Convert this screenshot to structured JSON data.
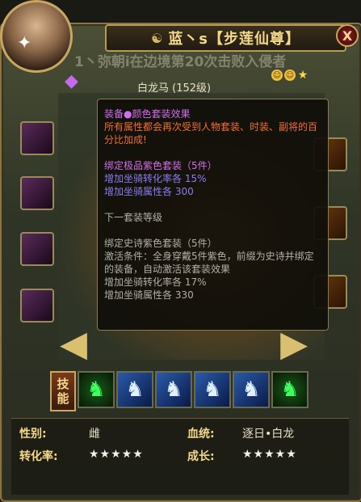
{
  "title": {
    "prefix_icon": "swirl-icon",
    "text": "蓝丶s【步莲仙尊】",
    "close_label": "X"
  },
  "scroll_text": "1丶弥朝i在边境第20次击败入侵者",
  "mount": {
    "name": "白龙马 (152级)"
  },
  "tooltip": {
    "title": "装备●颜色套装效果",
    "warning": "所有属性都会再次受到人物套装、时装、副将的百分比加成!",
    "current_set_title": "绑定极品紫色套装（5件）",
    "current_set_stat1": "增加坐骑转化率各   15%",
    "current_set_stat2": "增加坐骑属性各  300",
    "next_level_label": "下一套装等级",
    "next_set_title": "绑定史诗紫色套装（5件）",
    "next_set_condition": "激活条件：全身穿戴5件紫色，前缀为史诗并绑定的装备，自动激活该套装效果",
    "next_set_stat1": "增加坐骑转化率各   17%",
    "next_set_stat2": "增加坐骑属性各 330"
  },
  "skills": {
    "label_top": "技",
    "label_bottom": "能",
    "icons": [
      "horse-green-icon",
      "horse-blue-icon",
      "horse-blue-icon",
      "horse-blue-icon",
      "horse-blue-icon",
      "horse-green-icon"
    ]
  },
  "info": {
    "gender_label": "性别:",
    "gender_value": "雌",
    "bloodline_label": "血统:",
    "bloodline_value": "逐日•白龙",
    "conversion_label": "转化率:",
    "conversion_stars": "★★★★★",
    "growth_label": "成长:",
    "growth_stars": "★★★★★"
  },
  "colors": {
    "purple": "#d070e8",
    "orange": "#f07030",
    "blue": "#8a7ef0",
    "gold": "#f4d98a"
  }
}
